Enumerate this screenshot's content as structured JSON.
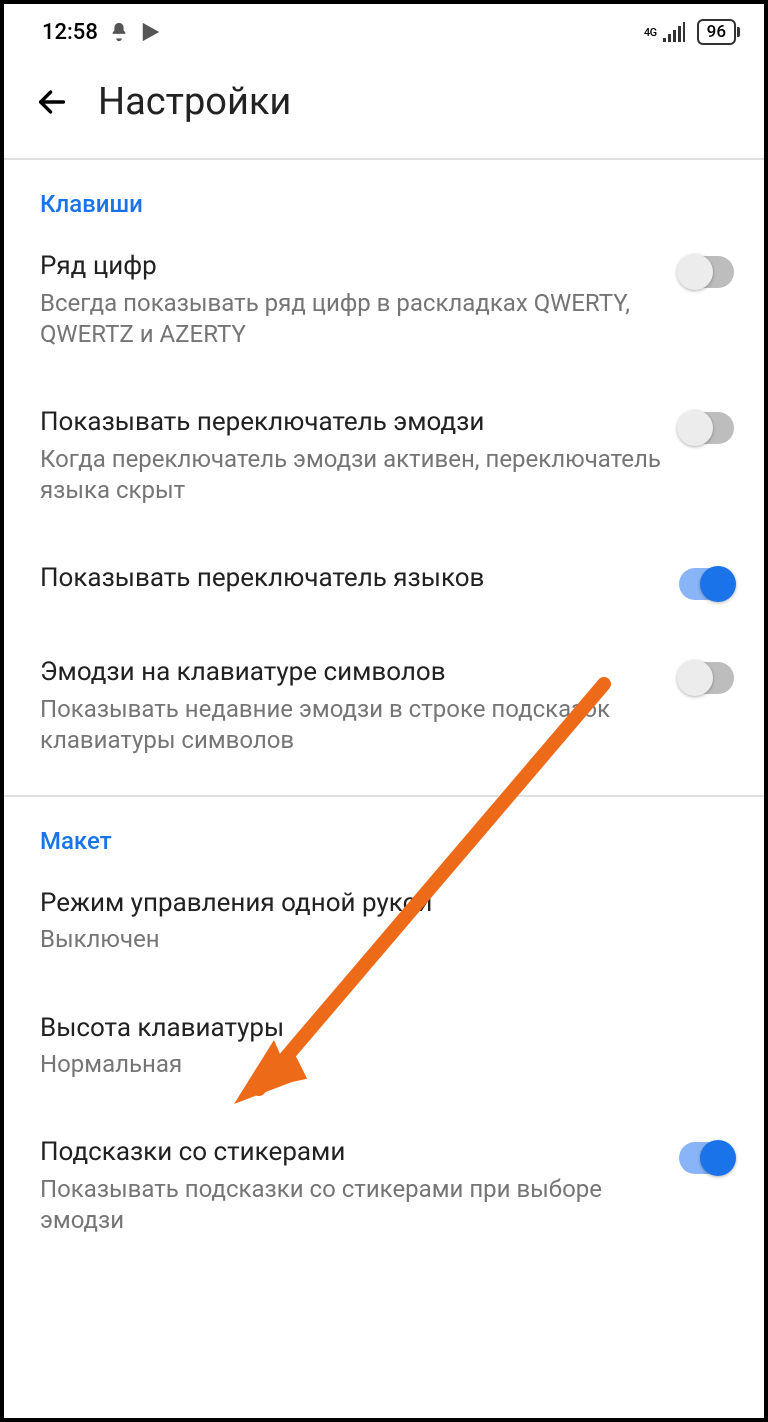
{
  "status": {
    "time": "12:58",
    "network_label": "4G",
    "battery_pct": "96"
  },
  "appbar": {
    "title": "Настройки"
  },
  "sections": {
    "keys": {
      "header": "Клавиши",
      "number_row": {
        "title": "Ряд цифр",
        "sub": "Всегда показывать ряд цифр в раскладках QWERTY, QWERTZ и AZERTY",
        "enabled": false
      },
      "emoji_switch": {
        "title": "Показывать переключатель эмодзи",
        "sub": "Когда переключатель эмодзи активен, переключатель языка скрыт",
        "enabled": false
      },
      "lang_switch": {
        "title": "Показывать переключатель языков",
        "enabled": true
      },
      "emoji_symbols": {
        "title": "Эмодзи на клавиатуре символов",
        "sub": "Показывать недавние эмодзи в строке подсказок клавиатуры символов",
        "enabled": false
      }
    },
    "layout": {
      "header": "Макет",
      "one_hand": {
        "title": "Режим управления одной рукой",
        "sub": "Выключен"
      },
      "kb_height": {
        "title": "Высота клавиатуры",
        "sub": "Нормальная"
      },
      "sticker_hints": {
        "title": "Подсказки со стикерами",
        "sub": "Показывать подсказки со стикерами при выборе эмодзи",
        "enabled": true
      }
    }
  }
}
